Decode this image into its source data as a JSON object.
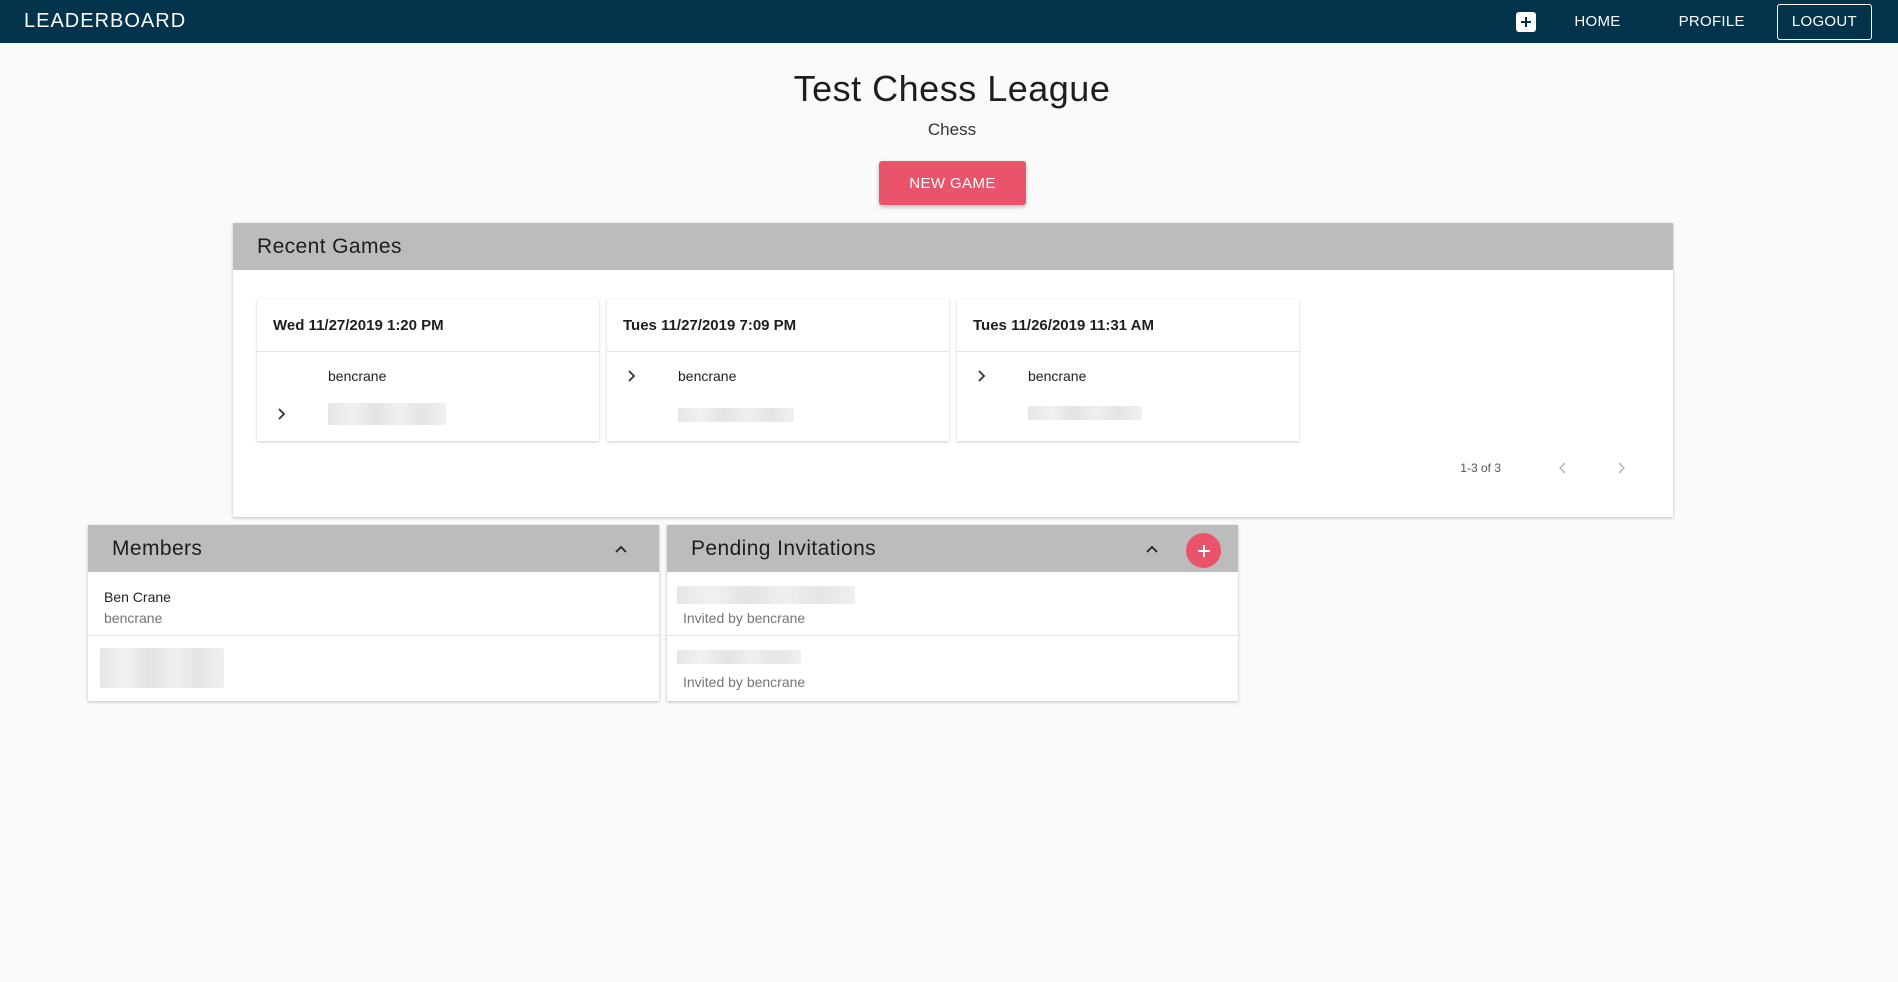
{
  "appbar": {
    "brand": "LEADERBOARD",
    "add_icon": "plus-square-icon",
    "home_label": "HOME",
    "profile_label": "PROFILE",
    "logout_label": "LOGOUT"
  },
  "league": {
    "title": "Test Chess League",
    "game": "Chess",
    "new_game_label": "NEW GAME"
  },
  "recent_games": {
    "title": "Recent Games",
    "games": [
      {
        "date": "Wed 11/27/2019 1:20 PM",
        "player1": "bencrane"
      },
      {
        "date": "Tues 11/27/2019 7:09 PM",
        "player1": "bencrane"
      },
      {
        "date": "Tues 11/26/2019 11:31 AM",
        "player1": "bencrane"
      }
    ],
    "pagination": {
      "label": "1-3 of 3"
    }
  },
  "members": {
    "title": "Members",
    "items": [
      {
        "name": "Ben Crane",
        "username": "bencrane"
      }
    ]
  },
  "invitations": {
    "title": "Pending Invitations",
    "items": [
      {
        "invited_by": "Invited by bencrane"
      },
      {
        "invited_by": "Invited by bencrane"
      }
    ]
  },
  "colors": {
    "appbar": "#04344c",
    "accent": "#e9546b",
    "panel_header": "#bcbcbc"
  }
}
